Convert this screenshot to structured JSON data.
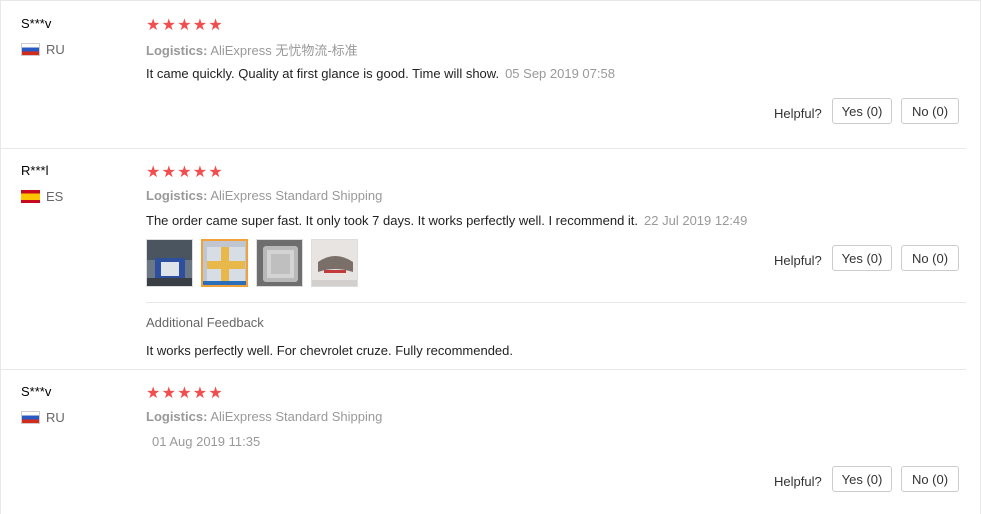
{
  "reviews": [
    {
      "user": "S***v",
      "country": "RU",
      "stars": [
        "★",
        "★",
        "★",
        "★",
        "★"
      ],
      "logistics_label": "Logistics:",
      "logistics_value": "AliExpress 无忧物流-标准",
      "content": "It came quickly. Quality at first glance is good. Time will show.",
      "time": "05 Sep 2019 07:58",
      "helpful_label": "Helpful?",
      "yes_label": "Yes (0)",
      "no_label": "No (0)"
    },
    {
      "user": "R***l",
      "country": "ES",
      "stars": [
        "★",
        "★",
        "★",
        "★",
        "★"
      ],
      "logistics_label": "Logistics:",
      "logistics_value": "AliExpress Standard Shipping",
      "content": "The order came super fast. It only took 7 days. It works perfectly well. I recommend it.",
      "time": "22 Jul 2019 12:49",
      "helpful_label": "Helpful?",
      "yes_label": "Yes (0)",
      "no_label": "No (0)",
      "additional_title": "Additional Feedback",
      "additional_content": "It works perfectly well. For chevrolet cruze. Fully recommended."
    },
    {
      "user": "S***v",
      "country": "RU",
      "stars": [
        "★",
        "★",
        "★",
        "★",
        "★"
      ],
      "logistics_label": "Logistics:",
      "logistics_value": "AliExpress Standard Shipping",
      "content": "",
      "time": "01 Aug 2019 11:35",
      "helpful_label": "Helpful?",
      "yes_label": "Yes (0)",
      "no_label": "No (0)"
    }
  ],
  "colors": {
    "star": "#f44d4d",
    "muted": "#999999",
    "selected_thumb_border": "#f2a13a"
  }
}
